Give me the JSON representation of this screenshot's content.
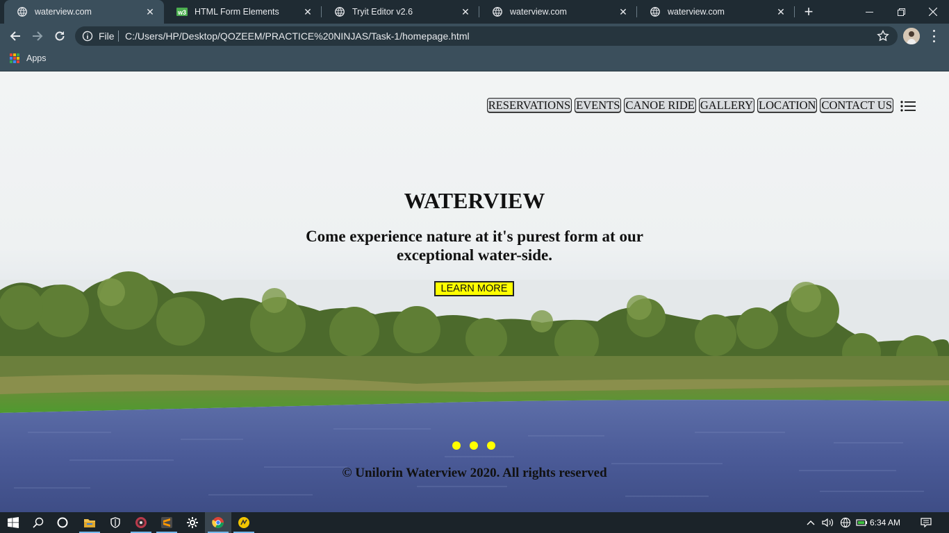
{
  "browser": {
    "tabs": [
      {
        "title": "waterview.com",
        "icon": "globe-icon",
        "active": true
      },
      {
        "title": "HTML Form Elements",
        "icon": "w3schools-icon",
        "active": false
      },
      {
        "title": "Tryit Editor v2.6",
        "icon": "globe-icon",
        "active": false
      },
      {
        "title": "waterview.com",
        "icon": "globe-icon",
        "active": false
      },
      {
        "title": "waterview.com",
        "icon": "globe-icon",
        "active": false
      }
    ],
    "address": {
      "scheme_label": "File",
      "url": "C:/Users/HP/Desktop/QOZEEM/PRACTICE%20NINJAS/Task-1/homepage.html"
    },
    "bookmarks": {
      "apps_label": "Apps"
    }
  },
  "page": {
    "nav": [
      "RESERVATIONS",
      "EVENTS",
      "CANOE RIDE",
      "GALLERY",
      "LOCATION",
      "CONTACT US"
    ],
    "hero": {
      "title": "WATERVIEW",
      "subtitle": "Come experience nature at it's purest form at our exceptional water-side.",
      "cta": "LEARN MORE"
    },
    "slider_dots": 3,
    "footer": "© Unilorin Waterview 2020. All rights reserved",
    "colors": {
      "accent": "#ffff00",
      "text": "#111111"
    }
  },
  "taskbar": {
    "clock": "6:34 AM",
    "apps": [
      "start-icon",
      "search-icon",
      "cortana-icon",
      "file-explorer-icon",
      "security-icon",
      "media-player-icon",
      "sublime-text-icon",
      "settings-icon",
      "chrome-icon",
      "app-icon"
    ]
  }
}
